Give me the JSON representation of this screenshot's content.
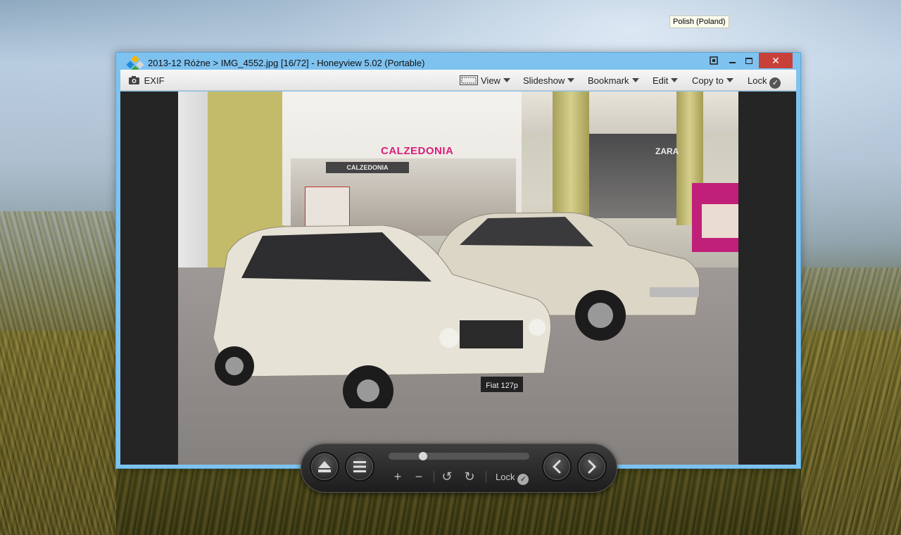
{
  "tooltip": {
    "text": "Polish (Poland)"
  },
  "window": {
    "title": "2013-12 Różne > IMG_4552.jpg [16/72] - Honeyview 5.02 (Portable)",
    "controls": {
      "fullscreen": "⛶",
      "minimize": "—",
      "maximize": "☐",
      "close": "✕"
    }
  },
  "toolbar": {
    "exif_label": "EXIF",
    "view_label": "View",
    "slideshow_label": "Slideshow",
    "bookmark_label": "Bookmark",
    "edit_label": "Edit",
    "copyto_label": "Copy to",
    "lock_label": "Lock"
  },
  "photo": {
    "store_sign": "CALZEDONIA",
    "store_sign_small": "CALZEDONIA",
    "zara_sign": "ZARA",
    "plate_text": "Fiat 127p"
  },
  "overlay": {
    "lock_label": "Lock",
    "slider_position": 0.23,
    "icons": [
      "eject-icon",
      "menu-icon",
      "zoom-in-icon",
      "zoom-out-icon",
      "rotate-left-icon",
      "rotate-right-icon",
      "check-icon",
      "prev-icon",
      "next-icon"
    ]
  },
  "colors": {
    "window_frame": "#7ec2f0",
    "close_button": "#c7403a",
    "store_sign": "#d81f7c"
  }
}
